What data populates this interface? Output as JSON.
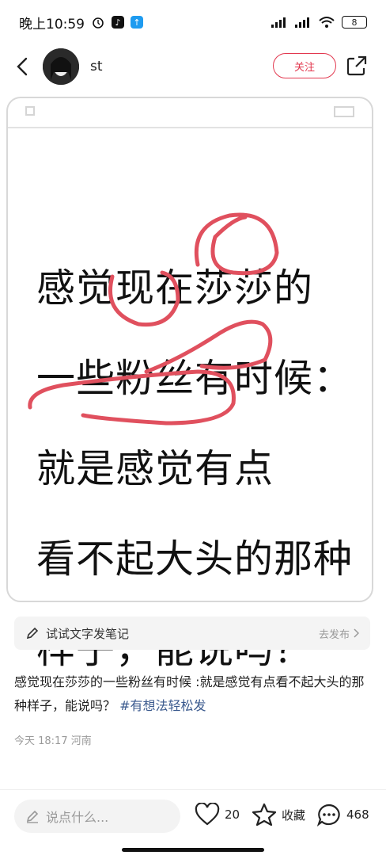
{
  "status_bar": {
    "time": "晚上10:59",
    "battery": "8"
  },
  "nav": {
    "username": "st",
    "follow_label": "关注"
  },
  "card": {
    "lines": [
      "感觉现在莎莎的",
      "一些粉丝有时候：",
      "就是感觉有点",
      "看不起大头的那种",
      "样子，能说吗？"
    ]
  },
  "note_bar": {
    "label": "试试文字发笔记",
    "publish": "去发布"
  },
  "post": {
    "text": "感觉现在莎莎的一些粉丝有时候 :就是感觉有点看不起大头的那种样子，能说吗？",
    "tag": "#有想法轻松发",
    "meta": "今天 18:17 河南"
  },
  "bottom": {
    "comment_placeholder": "说点什么...",
    "likes": "20",
    "collect_label": "收藏",
    "comments": "468"
  },
  "colors": {
    "accent": "#e2384f",
    "tag": "#3b5a8e",
    "scribble": "#e0505e"
  }
}
